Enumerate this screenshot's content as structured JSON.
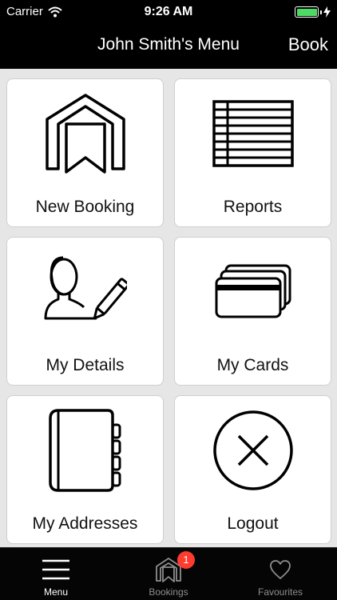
{
  "status_bar": {
    "carrier": "Carrier",
    "time": "9:26 AM",
    "battery_level": 1.0,
    "battery_color": "#4cd964"
  },
  "nav": {
    "title": "John Smith's Menu",
    "right_button": "Book"
  },
  "tiles": [
    {
      "label": "New Booking",
      "icon": "house-bookmark-icon"
    },
    {
      "label": "Reports",
      "icon": "ledger-list-icon"
    },
    {
      "label": "My Details",
      "icon": "user-edit-icon"
    },
    {
      "label": "My Cards",
      "icon": "credit-cards-icon"
    },
    {
      "label": "My Addresses",
      "icon": "address-book-icon"
    },
    {
      "label": "Logout",
      "icon": "close-circle-icon"
    }
  ],
  "tab_bar": {
    "tabs": [
      {
        "label": "Menu",
        "icon": "hamburger-menu-icon",
        "active": true
      },
      {
        "label": "Bookings",
        "icon": "bookings-icon",
        "active": false,
        "badge": "1"
      },
      {
        "label": "Favourites",
        "icon": "heart-icon",
        "active": false
      }
    ]
  },
  "colors": {
    "bar_background": "#000000",
    "content_background": "#e6e6e6",
    "badge": "#ff3b30",
    "inactive_tab": "#8e8e8e"
  }
}
